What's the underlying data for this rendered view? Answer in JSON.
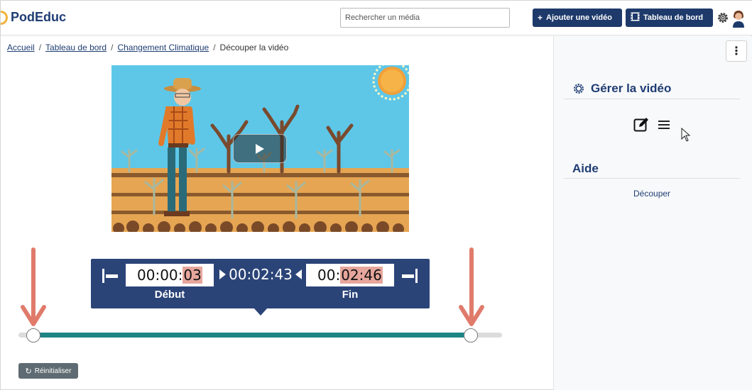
{
  "app": {
    "name": "PodEduc"
  },
  "header": {
    "search_placeholder": "Rechercher un média",
    "add_video_label": "Ajouter une vidéo",
    "add_video_icon": "+",
    "dashboard_label": "Tableau de bord"
  },
  "breadcrumb": {
    "items": [
      "Accueil",
      "Tableau de bord",
      "Changement Climatique"
    ],
    "current": "Découper la vidéo",
    "separator": "/"
  },
  "panel": {
    "kebab": "⋮",
    "manage_title": "Gérer la vidéo",
    "help_title": "Aide",
    "help_link": "Découper"
  },
  "trim": {
    "start": {
      "prefix": "00:00:",
      "highlight": "03"
    },
    "end": {
      "prefix": "00:",
      "highlight": "02:46"
    },
    "duration": "00:02:43",
    "start_label": "Début",
    "end_label": "Fin"
  },
  "slider": {
    "start_fraction": 0.03,
    "end_fraction": 0.93
  },
  "reset": {
    "icon": "↻",
    "label": "Réinitialiser"
  },
  "colors": {
    "brand": "#1f3d73",
    "button": "#1e3a6b",
    "trim_panel": "#2b4478",
    "range": "#1e8585",
    "highlight": "#e6a69c",
    "arrow": "#e07b6c"
  }
}
